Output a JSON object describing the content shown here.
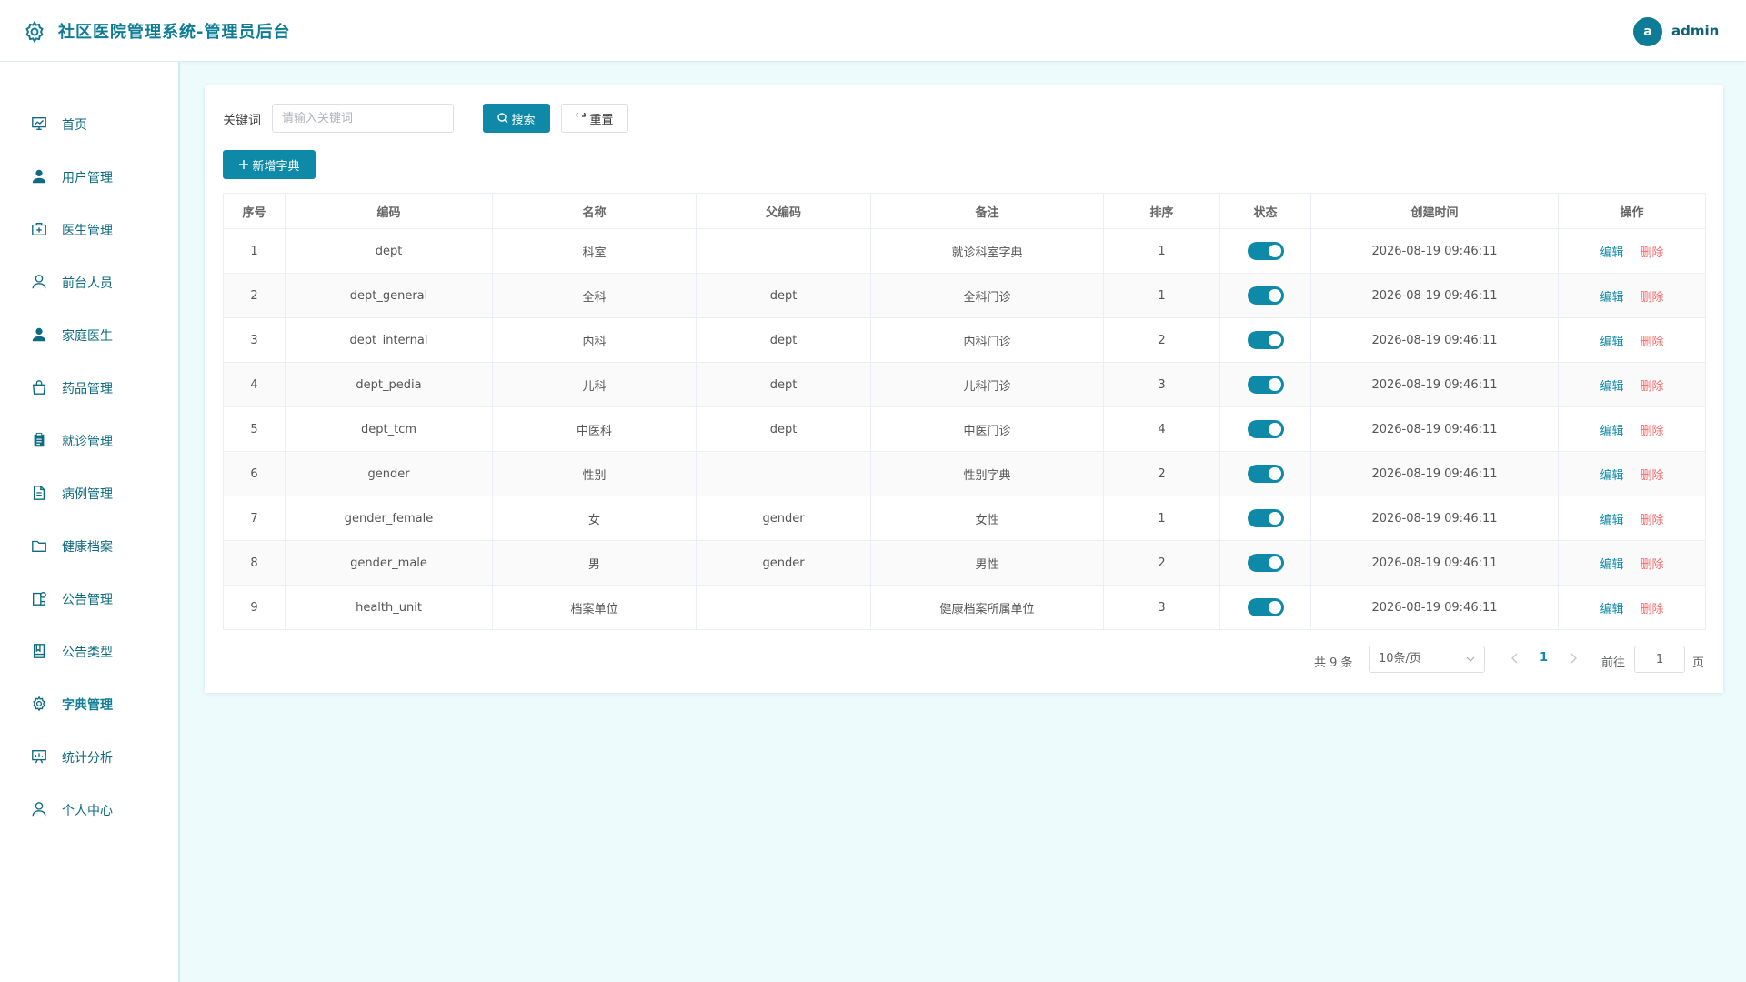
{
  "header": {
    "title": "社区医院管理系统-管理员后台",
    "avatar_letter": "a",
    "username": "admin"
  },
  "sidebar": {
    "items": [
      {
        "label": "首页",
        "icon": "dashboard-icon"
      },
      {
        "label": "用户管理",
        "icon": "user-icon"
      },
      {
        "label": "医生管理",
        "icon": "medical-kit-icon"
      },
      {
        "label": "前台人员",
        "icon": "person-outline-icon"
      },
      {
        "label": "家庭医生",
        "icon": "user-icon"
      },
      {
        "label": "药品管理",
        "icon": "bag-icon"
      },
      {
        "label": "就诊管理",
        "icon": "clipboard-icon"
      },
      {
        "label": "病例管理",
        "icon": "document-icon"
      },
      {
        "label": "健康档案",
        "icon": "folder-icon"
      },
      {
        "label": "公告管理",
        "icon": "notice-icon"
      },
      {
        "label": "公告类型",
        "icon": "notebook-icon"
      },
      {
        "label": "字典管理",
        "icon": "gear-icon"
      },
      {
        "label": "统计分析",
        "icon": "chart-board-icon"
      },
      {
        "label": "个人中心",
        "icon": "person-outline-icon"
      }
    ],
    "active": "字典管理"
  },
  "search": {
    "label": "关键词",
    "placeholder": "请输入关键词",
    "value": "",
    "search_label": "搜索",
    "reset_label": "重置",
    "add_label": "新增字典"
  },
  "table": {
    "columns": [
      "序号",
      "编码",
      "名称",
      "父编码",
      "备注",
      "排序",
      "状态",
      "创建时间",
      "操作"
    ],
    "rows": [
      {
        "no": "1",
        "code": "dept",
        "name": "科室",
        "parent": "",
        "remark": "就诊科室字典",
        "sort": "1",
        "enabled": true,
        "created": "2026-08-19 09:46:11"
      },
      {
        "no": "2",
        "code": "dept_general",
        "name": "全科",
        "parent": "dept",
        "remark": "全科门诊",
        "sort": "1",
        "enabled": true,
        "created": "2026-08-19 09:46:11"
      },
      {
        "no": "3",
        "code": "dept_internal",
        "name": "内科",
        "parent": "dept",
        "remark": "内科门诊",
        "sort": "2",
        "enabled": true,
        "created": "2026-08-19 09:46:11"
      },
      {
        "no": "4",
        "code": "dept_pedia",
        "name": "儿科",
        "parent": "dept",
        "remark": "儿科门诊",
        "sort": "3",
        "enabled": true,
        "created": "2026-08-19 09:46:11"
      },
      {
        "no": "5",
        "code": "dept_tcm",
        "name": "中医科",
        "parent": "dept",
        "remark": "中医门诊",
        "sort": "4",
        "enabled": true,
        "created": "2026-08-19 09:46:11"
      },
      {
        "no": "6",
        "code": "gender",
        "name": "性别",
        "parent": "",
        "remark": "性别字典",
        "sort": "2",
        "enabled": true,
        "created": "2026-08-19 09:46:11"
      },
      {
        "no": "7",
        "code": "gender_female",
        "name": "女",
        "parent": "gender",
        "remark": "女性",
        "sort": "1",
        "enabled": true,
        "created": "2026-08-19 09:46:11"
      },
      {
        "no": "8",
        "code": "gender_male",
        "name": "男",
        "parent": "gender",
        "remark": "男性",
        "sort": "2",
        "enabled": true,
        "created": "2026-08-19 09:46:11"
      },
      {
        "no": "9",
        "code": "health_unit",
        "name": "档案单位",
        "parent": "",
        "remark": "健康档案所属单位",
        "sort": "3",
        "enabled": true,
        "created": "2026-08-19 09:46:11"
      }
    ],
    "edit_label": "编辑",
    "delete_label": "删除"
  },
  "pagination": {
    "total_text": "共 9 条",
    "page_size": "10条/页",
    "current_page": "1",
    "goto_label": "前往",
    "goto_value": "1",
    "unit_label": "页"
  },
  "colors": {
    "primary": "#0e8aa8",
    "danger": "#f56c6c",
    "background": "#eefbfd"
  }
}
